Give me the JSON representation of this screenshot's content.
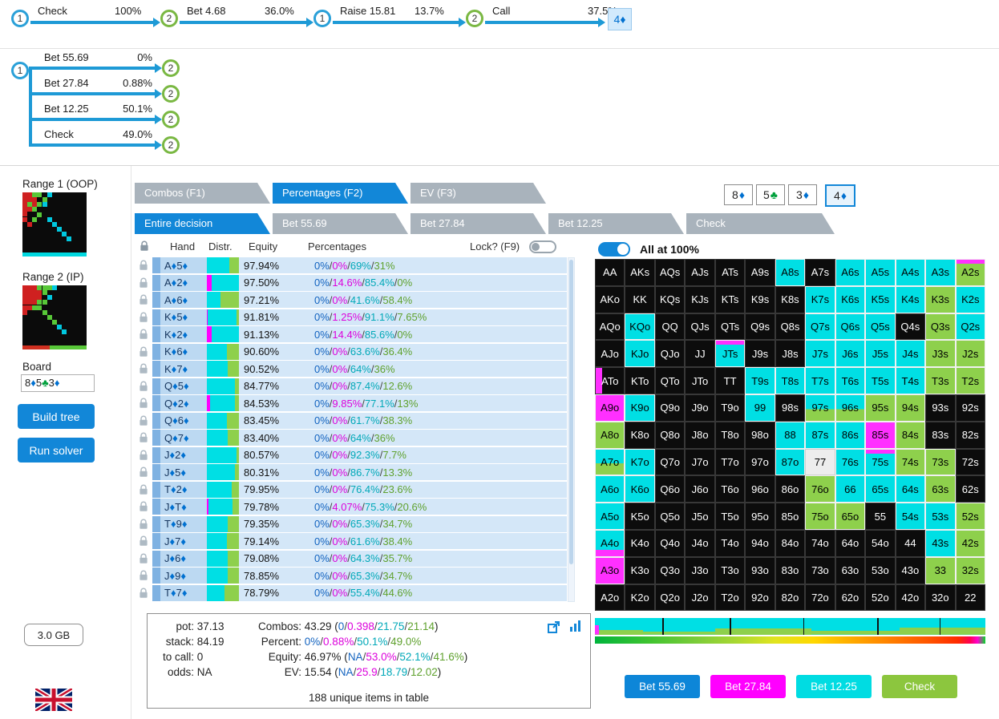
{
  "colors": {
    "accent": "#1287d8",
    "node_blue": "#2aa0d8",
    "node_green": "#7ab843",
    "slot_fill": [
      "#0d86d8",
      "#ff00ff",
      "#00dfe4",
      "#8ed04c"
    ],
    "slot_text": [
      "#1464c0",
      "#dc00dc",
      "#00a8b8",
      "#5fa12e"
    ]
  },
  "icons": {
    "lock": "lock-icon",
    "export": "export-icon",
    "chart": "bar-chart-icon",
    "flag": "uk-flag-icon",
    "arrowhead": "tree-arrowhead-icon"
  },
  "top_tree": {
    "steps": [
      {
        "node": "1",
        "ring": "blue",
        "action": "Check",
        "pct": "100%"
      },
      {
        "node": "2",
        "ring": "green",
        "action": "Bet 4.68",
        "pct": "36.0%"
      },
      {
        "node": "1",
        "ring": "blue",
        "action": "Raise 15.81",
        "pct": "13.7%"
      },
      {
        "node": "2",
        "ring": "green",
        "action": "Call",
        "pct": "37.5%"
      }
    ],
    "terminal_card": "4♦"
  },
  "flop_tree": {
    "root_node": "1",
    "branches": [
      {
        "action": "Bet 55.69",
        "pct": "0%",
        "node": "2"
      },
      {
        "action": "Bet 27.84",
        "pct": "0.88%",
        "node": "2"
      },
      {
        "action": "Bet 12.25",
        "pct": "50.1%",
        "node": "2"
      },
      {
        "action": "Check",
        "pct": "49.0%",
        "node": "2"
      }
    ]
  },
  "sidebar": {
    "range1_label": "Range 1 (OOP)",
    "range2_label": "Range 2 (IP)",
    "board_label": "Board",
    "board_value": "8♦5♣3♦",
    "build_tree_button": "Build tree",
    "run_solver_button": "Run solver",
    "memory_badge": "3.0 GB"
  },
  "view_tabs": [
    {
      "label": "Combos (F1)",
      "active": false
    },
    {
      "label": "Percentages (F2)",
      "active": true
    },
    {
      "label": "EV (F3)",
      "active": false
    }
  ],
  "board_cards": [
    {
      "rank": "8",
      "suit": "♦",
      "suit_color": "#0070d0",
      "selected": false
    },
    {
      "rank": "5",
      "suit": "♣",
      "suit_color": "#00a03c",
      "selected": false
    },
    {
      "rank": "3",
      "suit": "♦",
      "suit_color": "#0070d0",
      "selected": false
    },
    {
      "rank": "4",
      "suit": "♦",
      "suit_color": "#0070d0",
      "selected": true
    }
  ],
  "decision_tabs": [
    {
      "label": "Entire decision",
      "active": true
    },
    {
      "label": "Bet 55.69",
      "active": false
    },
    {
      "label": "Bet 27.84",
      "active": false
    },
    {
      "label": "Bet 12.25",
      "active": false
    },
    {
      "label": "Check",
      "active": false
    }
  ],
  "table": {
    "headers": {
      "hand": "Hand",
      "distr": "Distr.",
      "equity": "Equity",
      "percentages": "Percentages",
      "lock": "Lock? (F9)"
    },
    "rows": [
      {
        "hand": "A♦5♦",
        "equity": "97.94%",
        "pcts": [
          "0%",
          "0%",
          "69%",
          "31%"
        ]
      },
      {
        "hand": "A♦2♦",
        "equity": "97.50%",
        "pcts": [
          "0%",
          "14.6%",
          "85.4%",
          "0%"
        ]
      },
      {
        "hand": "A♦6♦",
        "equity": "97.21%",
        "pcts": [
          "0%",
          "0%",
          "41.6%",
          "58.4%"
        ]
      },
      {
        "hand": "K♦5♦",
        "equity": "91.81%",
        "pcts": [
          "0%",
          "1.25%",
          "91.1%",
          "7.65%"
        ]
      },
      {
        "hand": "K♦2♦",
        "equity": "91.13%",
        "pcts": [
          "0%",
          "14.4%",
          "85.6%",
          "0%"
        ]
      },
      {
        "hand": "K♦6♦",
        "equity": "90.60%",
        "pcts": [
          "0%",
          "0%",
          "63.6%",
          "36.4%"
        ]
      },
      {
        "hand": "K♦7♦",
        "equity": "90.52%",
        "pcts": [
          "0%",
          "0%",
          "64%",
          "36%"
        ]
      },
      {
        "hand": "Q♦5♦",
        "equity": "84.77%",
        "pcts": [
          "0%",
          "0%",
          "87.4%",
          "12.6%"
        ]
      },
      {
        "hand": "Q♦2♦",
        "equity": "84.53%",
        "pcts": [
          "0%",
          "9.85%",
          "77.1%",
          "13%"
        ]
      },
      {
        "hand": "Q♦6♦",
        "equity": "83.45%",
        "pcts": [
          "0%",
          "0%",
          "61.7%",
          "38.3%"
        ]
      },
      {
        "hand": "Q♦7♦",
        "equity": "83.40%",
        "pcts": [
          "0%",
          "0%",
          "64%",
          "36%"
        ]
      },
      {
        "hand": "J♦2♦",
        "equity": "80.57%",
        "pcts": [
          "0%",
          "0%",
          "92.3%",
          "7.7%"
        ]
      },
      {
        "hand": "J♦5♦",
        "equity": "80.31%",
        "pcts": [
          "0%",
          "0%",
          "86.7%",
          "13.3%"
        ]
      },
      {
        "hand": "T♦2♦",
        "equity": "79.95%",
        "pcts": [
          "0%",
          "0%",
          "76.4%",
          "23.6%"
        ]
      },
      {
        "hand": "J♦T♦",
        "equity": "79.78%",
        "pcts": [
          "0%",
          "4.07%",
          "75.3%",
          "20.6%"
        ]
      },
      {
        "hand": "T♦9♦",
        "equity": "79.35%",
        "pcts": [
          "0%",
          "0%",
          "65.3%",
          "34.7%"
        ]
      },
      {
        "hand": "J♦7♦",
        "equity": "79.14%",
        "pcts": [
          "0%",
          "0%",
          "61.6%",
          "38.4%"
        ]
      },
      {
        "hand": "J♦6♦",
        "equity": "79.08%",
        "pcts": [
          "0%",
          "0%",
          "64.3%",
          "35.7%"
        ]
      },
      {
        "hand": "J♦9♦",
        "equity": "78.85%",
        "pcts": [
          "0%",
          "0%",
          "65.3%",
          "34.7%"
        ]
      },
      {
        "hand": "T♦7♦",
        "equity": "78.79%",
        "pcts": [
          "0%",
          "0%",
          "55.4%",
          "44.6%"
        ]
      }
    ]
  },
  "summary": {
    "left": [
      {
        "label": "pot:",
        "value": "37.13"
      },
      {
        "label": "stack:",
        "value": "84.19"
      },
      {
        "label": "to call:",
        "value": "0"
      },
      {
        "label": "odds:",
        "value": "NA"
      }
    ],
    "right": [
      {
        "label": "Combos:",
        "prefix": "43.29 (",
        "values": [
          "0",
          "0.398",
          "21.75",
          "21.14"
        ],
        "suffix": ")"
      },
      {
        "label": "Percent:",
        "prefix": "",
        "values": [
          "0%",
          "0.88%",
          "50.1%",
          "49.0%"
        ],
        "suffix": ""
      },
      {
        "label": "Equity:",
        "prefix": "46.97% (",
        "values": [
          "NA",
          "53.0%",
          "52.1%",
          "41.6%"
        ],
        "suffix": ")"
      },
      {
        "label": "EV:",
        "prefix": "15.54 (",
        "values": [
          "NA",
          "25.9",
          "18.79",
          "12.02"
        ],
        "suffix": ")"
      }
    ],
    "note": "188 unique items in table"
  },
  "matrix": {
    "toggle_label": "All at 100%",
    "rows": [
      [
        "AA|k",
        "AKs|k",
        "AQs|k",
        "AJs|k",
        "ATs|k",
        "A9s|k",
        "A8s|c",
        "A7s|k",
        "A6s|c",
        "A5s|c",
        "A4s|c",
        "A3s|c",
        "A2s|gm"
      ],
      [
        "AKo|k",
        "KK|k",
        "KQs|k",
        "KJs|k",
        "KTs|k",
        "K9s|k",
        "K8s|k",
        "K7s|c",
        "K6s|c",
        "K5s|c",
        "K4s|c",
        "K3s|g",
        "K2s|c"
      ],
      [
        "AQo|k",
        "KQo|c",
        "QQ|k",
        "QJs|k",
        "QTs|k",
        "Q9s|k",
        "Q8s|k",
        "Q7s|c",
        "Q6s|c",
        "Q5s|c",
        "Q4s|k",
        "Q3s|g",
        "Q2s|c"
      ],
      [
        "AJo|k",
        "KJo|c",
        "QJo|k",
        "JJ|k",
        "JTs|cm",
        "J9s|k",
        "J8s|k",
        "J7s|c",
        "J6s|c",
        "J5s|c",
        "J4s|c",
        "J3s|g",
        "J2s|g"
      ],
      [
        "ATo|km",
        "KTo|k",
        "QTo|k",
        "JTo|k",
        "TT|k",
        "T9s|c",
        "T8s|c",
        "T7s|c",
        "T6s|c",
        "T5s|c",
        "T4s|c",
        "T3s|g",
        "T2s|g"
      ],
      [
        "A9o|m",
        "K9o|c",
        "Q9o|k",
        "J9o|k",
        "T9o|k",
        "99|c",
        "98s|k",
        "97s|cg",
        "96s|cg",
        "95s|g",
        "94s|g",
        "93s|k",
        "92s|k"
      ],
      [
        "A8o|g",
        "K8o|k",
        "Q8o|k",
        "J8o|k",
        "T8o|k",
        "98o|k",
        "88|c",
        "87s|c",
        "86s|c",
        "85s|m",
        "84s|g",
        "83s|k",
        "82s|k"
      ],
      [
        "A7o|cg",
        "K7o|c",
        "Q7o|k",
        "J7o|k",
        "T7o|k",
        "97o|k",
        "87o|c",
        "77|w",
        "76s|c",
        "75s|cm",
        "74s|g",
        "73s|g",
        "72s|k"
      ],
      [
        "A6o|c",
        "K6o|c",
        "Q6o|k",
        "J6o|k",
        "T6o|k",
        "96o|k",
        "86o|k",
        "76o|g",
        "66|c",
        "65s|c",
        "64s|c",
        "63s|g",
        "62s|k"
      ],
      [
        "A5o|c",
        "K5o|k",
        "Q5o|k",
        "J5o|k",
        "T5o|k",
        "95o|k",
        "85o|k",
        "75o|g",
        "65o|g",
        "55|k",
        "54s|c",
        "53s|c",
        "52s|g"
      ],
      [
        "A4o|cb",
        "K4o|k",
        "Q4o|k",
        "J4o|k",
        "T4o|k",
        "94o|k",
        "84o|k",
        "74o|k",
        "64o|k",
        "54o|k",
        "44|k",
        "43s|c",
        "42s|g"
      ],
      [
        "A3o|m",
        "K3o|k",
        "Q3o|k",
        "J3o|k",
        "T3o|k",
        "93o|k",
        "83o|k",
        "73o|k",
        "63o|k",
        "53o|k",
        "43o|k",
        "33|g",
        "32s|g"
      ],
      [
        "A2o|k",
        "K2o|k",
        "Q2o|k",
        "J2o|k",
        "T2o|k",
        "92o|k",
        "82o|k",
        "72o|k",
        "62o|k",
        "52o|k",
        "42o|k",
        "32o|k",
        "22|k"
      ]
    ]
  },
  "action_buttons": [
    {
      "label": "Bet 55.69",
      "color": "#0d86d8"
    },
    {
      "label": "Bet 27.84",
      "color": "#ff00ff"
    },
    {
      "label": "Bet 12.25",
      "color": "#00dce2"
    },
    {
      "label": "Check",
      "color": "#8cc63e"
    }
  ]
}
